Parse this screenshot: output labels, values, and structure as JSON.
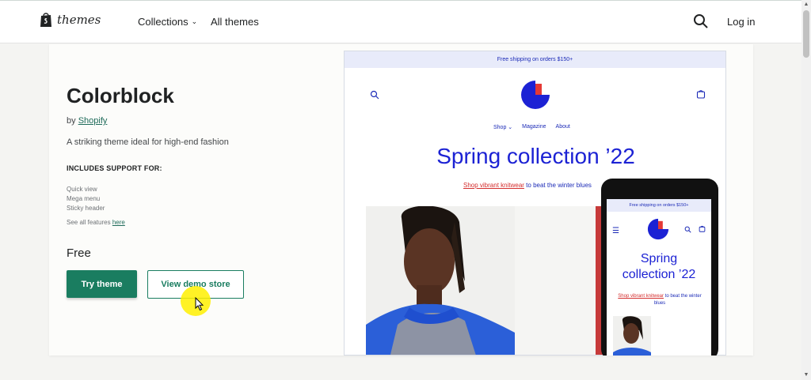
{
  "nav": {
    "logo_text": "themes",
    "collections": "Collections",
    "all_themes": "All themes",
    "login": "Log in"
  },
  "theme": {
    "title": "Colorblock",
    "by_prefix": "by",
    "author": "Shopify",
    "description": "A striking theme ideal for high-end fashion",
    "support_heading": "INCLUDES SUPPORT FOR:",
    "features": [
      "Quick view",
      "Mega menu",
      "Sticky header"
    ],
    "see_all_prefix": "See all features",
    "see_all_link": "here",
    "price": "Free",
    "try_button": "Try theme",
    "demo_button": "View demo store"
  },
  "preview": {
    "shipping": "Free shipping on orders $150+",
    "nav": [
      "Shop",
      "Magazine",
      "About"
    ],
    "headline": "Spring collection ’22",
    "sub_link": "Shop vibrant knitwear",
    "sub_rest": "to beat the winter blues"
  },
  "phone": {
    "shipping": "Free shipping on orders $150+",
    "headline_line1": "Spring",
    "headline_line2": "collection ’22",
    "sub_link": "Shop vibrant knitwear",
    "sub_rest": "to beat the winter blues"
  },
  "colors": {
    "brand_green": "#1a7d60",
    "preview_blue": "#1c22d4",
    "preview_red": "#d42e2e"
  }
}
